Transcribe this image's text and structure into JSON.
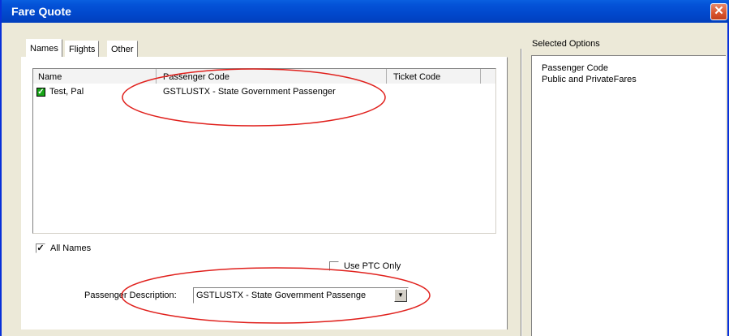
{
  "window": {
    "title": "Fare Quote",
    "close_label": "✕"
  },
  "tabs": [
    {
      "label": "Names",
      "active": true
    },
    {
      "label": "Flights",
      "active": false
    },
    {
      "label": "Other",
      "active": false
    }
  ],
  "passenger_list": {
    "columns": [
      "Name",
      "Passenger Code",
      "Ticket Code"
    ],
    "rows": [
      {
        "checked": true,
        "name": "Test, Pal",
        "passenger_code": "GSTLUSTX - State Government Passenger",
        "ticket_code": ""
      }
    ]
  },
  "all_names": {
    "label": "All Names",
    "checked": true
  },
  "use_ptc_only": {
    "label": "Use PTC Only",
    "checked": false
  },
  "passenger_description": {
    "label": "Passenger Description:",
    "value": "GSTLUSTX - State Government Passenge"
  },
  "selected_options": {
    "title": "Selected Options",
    "items": [
      "Passenger Code",
      "Public and PrivateFares"
    ]
  },
  "colors": {
    "title_bar": "#0148cc",
    "dialog_face": "#ece9d8",
    "annotation": "#e0201c"
  }
}
